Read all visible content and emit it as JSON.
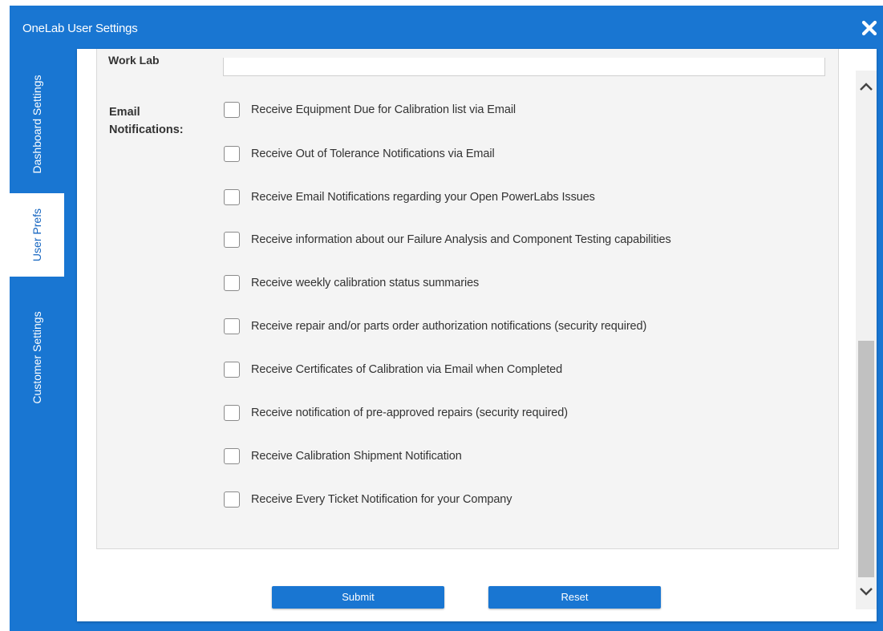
{
  "window": {
    "title": "OneLab User Settings"
  },
  "tabs": [
    {
      "label": "Dashboard Settings",
      "active": false
    },
    {
      "label": "User Prefs",
      "active": true
    },
    {
      "label": "Customer Settings",
      "active": false
    }
  ],
  "form": {
    "worklab_label": "Work Lab",
    "worklab_value": "",
    "email_section_label": "Email Notifications:",
    "options": [
      {
        "label": "Receive Equipment Due for Calibration list via Email",
        "checked": false
      },
      {
        "label": "Receive Out of Tolerance Notifications via Email",
        "checked": false
      },
      {
        "label": "Receive Email Notifications regarding your Open PowerLabs Issues",
        "checked": false
      },
      {
        "label": "Receive information about our Failure Analysis and Component Testing capabilities",
        "checked": false
      },
      {
        "label": "Receive weekly calibration status summaries",
        "checked": false
      },
      {
        "label": "Receive repair and/or parts order authorization notifications (security required)",
        "checked": false
      },
      {
        "label": "Receive Certificates of Calibration via Email when Completed",
        "checked": false
      },
      {
        "label": "Receive notification of pre-approved repairs (security required)",
        "checked": false
      },
      {
        "label": "Receive Calibration Shipment Notification",
        "checked": false
      },
      {
        "label": "Receive Every Ticket Notification for your Company",
        "checked": false
      }
    ]
  },
  "buttons": {
    "submit": "Submit",
    "reset": "Reset"
  },
  "icons": {
    "close": "close-icon",
    "scroll_up": "chevron-up-icon",
    "scroll_down": "chevron-down-icon"
  },
  "colors": {
    "accent": "#1976d2",
    "panel": "#f4f4f4"
  }
}
